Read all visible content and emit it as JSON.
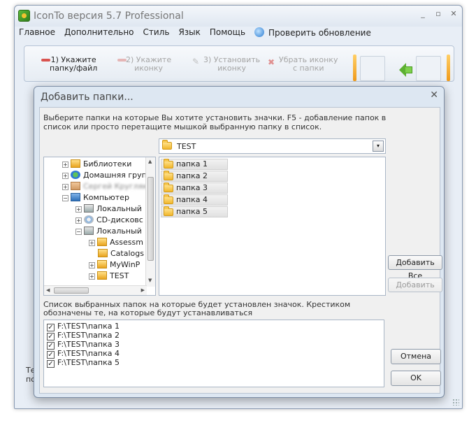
{
  "window": {
    "title": "IconTo версия 5.7 Professional",
    "minimize": "_",
    "maximize": "▫",
    "close": "✕"
  },
  "menu": [
    "Главное",
    "Дополнительно",
    "Стиль",
    "Язык",
    "Помощь"
  ],
  "menu_update": "Проверить обновление",
  "steps": [
    {
      "line1": "1)  Укажите",
      "line2": "папку/файл"
    },
    {
      "line1": "2)  Укажите",
      "line2": "иконку"
    },
    {
      "line1": "3)  Установить",
      "line2": "иконку"
    },
    {
      "line1": "Убрать иконку",
      "line2": "с папки"
    }
  ],
  "background_text": {
    "line1": "Те",
    "line2": "по"
  },
  "dialog": {
    "title": "Добавить папки...",
    "close": "✕",
    "hint": "Выберите папки на которые Вы хотите установить значки. F5 - добавление папок в список или просто перетащите мышкой выбранную папку в список.",
    "current_path": "TEST",
    "combo_arrow": "▾",
    "tree": [
      {
        "label": "Библиотеки",
        "sign": "+",
        "icon": "libraries-icon"
      },
      {
        "label": "Домашняя груп",
        "sign": "+",
        "icon": "homegroup-icon"
      },
      {
        "label": "Сергей Кругляк",
        "sign": "+",
        "icon": "user-icon"
      },
      {
        "label": "Компьютер",
        "sign": "−",
        "icon": "computer-icon"
      },
      {
        "label": "Локальный",
        "sign": "+",
        "icon": "local-disk-icon"
      },
      {
        "label": "CD-дисковс",
        "sign": "+",
        "icon": "cd-drive-icon"
      },
      {
        "label": "Локальный",
        "sign": "−",
        "icon": "local-disk-icon"
      },
      {
        "label": "Assessm",
        "sign": "+",
        "icon": "folder-icon"
      },
      {
        "label": "Catalogs",
        "sign": "",
        "icon": "folder-icon"
      },
      {
        "label": "MyWinP",
        "sign": "+",
        "icon": "folder-icon"
      },
      {
        "label": "TEST",
        "sign": "+",
        "icon": "folder-icon"
      }
    ],
    "folders": [
      "папка 1",
      "папка 2",
      "папка 3",
      "папка 4",
      "папка 5"
    ],
    "add_all_button": "Добавить Все",
    "add_button": "Добавить",
    "selected_label": "Список выбранных папок на которые будет установлен значок. Крестиком обозначены те, на которые будут устанавливаться",
    "selected": [
      {
        "path": "F:\\TEST\\папка 1",
        "checked": true
      },
      {
        "path": "F:\\TEST\\папка 2",
        "checked": true
      },
      {
        "path": "F:\\TEST\\папка 3",
        "checked": true
      },
      {
        "path": "F:\\TEST\\папка 4",
        "checked": true
      },
      {
        "path": "F:\\TEST\\папка 5",
        "checked": true
      }
    ],
    "cancel_button": "Отмена",
    "ok_button": "OK"
  }
}
